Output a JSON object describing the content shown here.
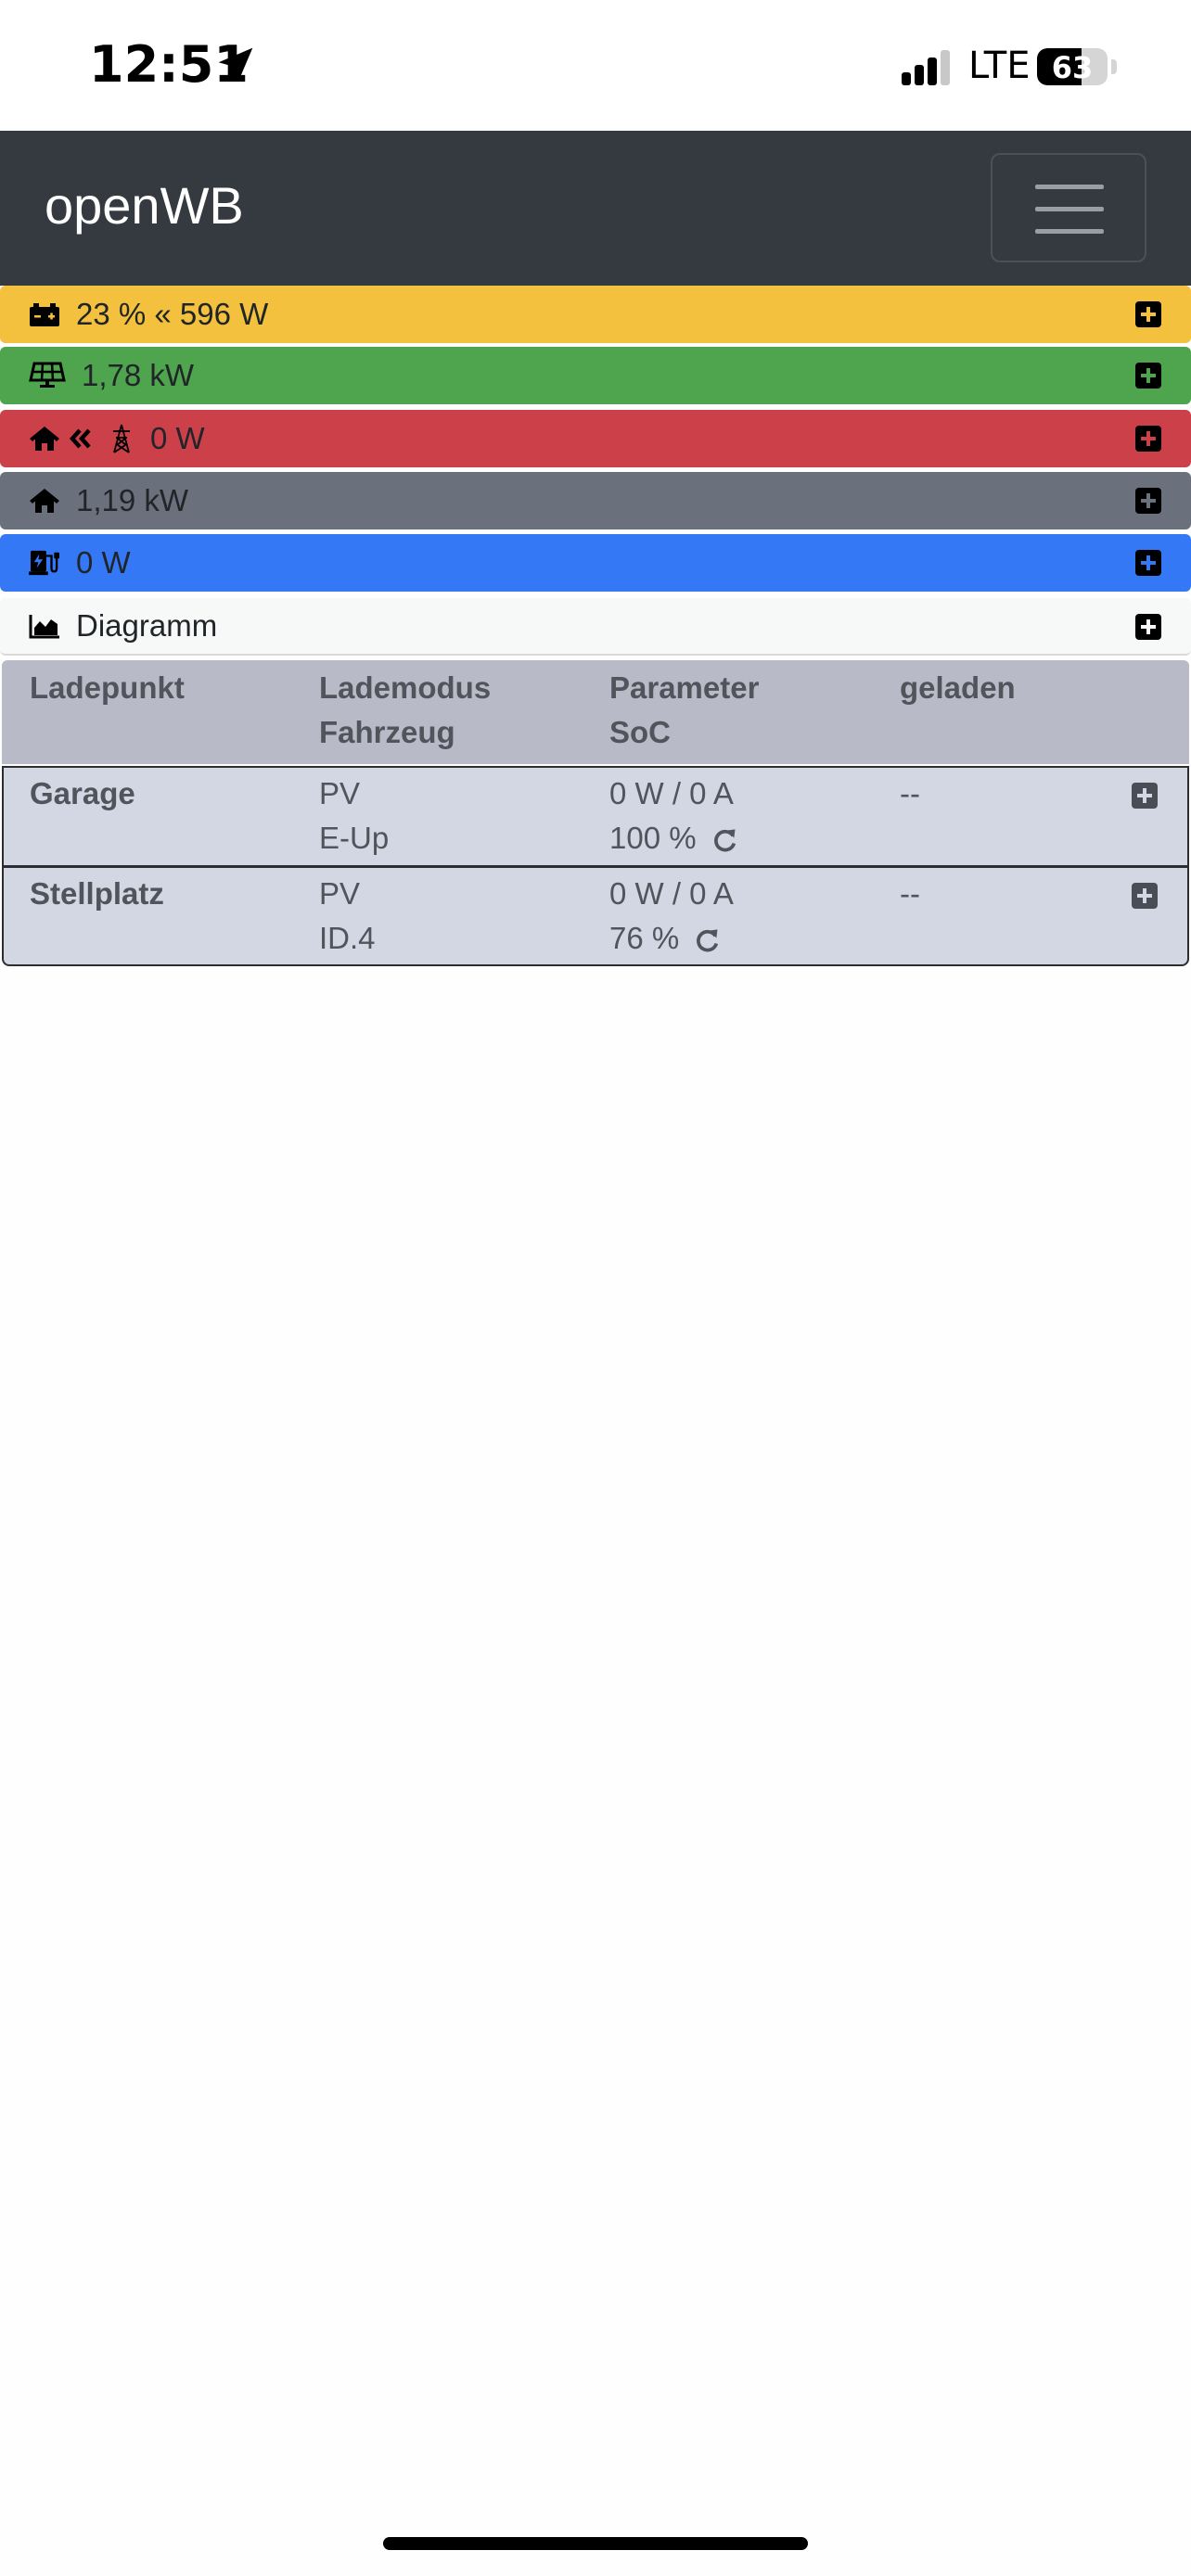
{
  "status_bar": {
    "time": "12:51",
    "network": "LTE",
    "battery": "63",
    "battery_level": 0.63
  },
  "navbar": {
    "brand": "openWB"
  },
  "bars": {
    "battery": {
      "label": "23 % « 596 W",
      "color": "#f3c13d"
    },
    "pv": {
      "label": "1,78 kW",
      "color": "#4fa44e"
    },
    "grid": {
      "label": "0 W",
      "color": "#cc404a"
    },
    "house": {
      "label": "1,19 kW",
      "color": "#6b717c"
    },
    "charge": {
      "label": "0 W",
      "color": "#3478f6"
    },
    "diagram": {
      "label": "Diagramm",
      "color": "#f7f8f8"
    }
  },
  "table": {
    "headers": {
      "col1": "Ladepunkt",
      "col2a": "Lademodus",
      "col2b": "Fahrzeug",
      "col3a": "Parameter",
      "col3b": "SoC",
      "col4": "geladen"
    },
    "rows": [
      {
        "name": "Garage",
        "mode": "PV",
        "vehicle": "E-Up",
        "param": "0 W / 0 A",
        "soc": "100 %",
        "charged": "--"
      },
      {
        "name": "Stellplatz",
        "mode": "PV",
        "vehicle": "ID.4",
        "param": "0 W / 0 A",
        "soc": "76 %",
        "charged": "--"
      }
    ]
  }
}
